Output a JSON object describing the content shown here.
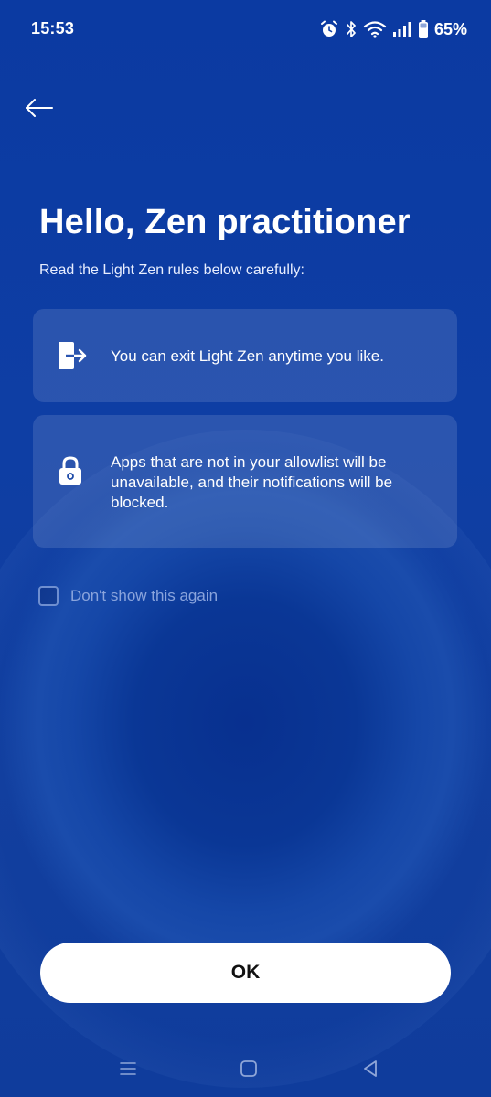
{
  "status_bar": {
    "time": "15:53",
    "battery_percent": "65%",
    "icons": [
      "alarm-icon",
      "bluetooth-icon",
      "wifi-icon",
      "signal-icon",
      "battery-icon"
    ]
  },
  "header": {
    "back_icon": "back-arrow-icon",
    "title": "Hello, Zen practitioner",
    "subtitle": "Read the Light Zen rules below carefully:"
  },
  "rules": [
    {
      "icon": "exit-icon",
      "text": "You can exit Light Zen anytime you like."
    },
    {
      "icon": "lock-icon",
      "text": "Apps that are not in your allowlist will be unavailable, and their notifications will be blocked."
    }
  ],
  "dont_show_again": {
    "label": "Don't show this again",
    "checked": false
  },
  "ok_button": {
    "label": "OK"
  },
  "nav_bar": {
    "icons": [
      "recent-apps-icon",
      "home-icon",
      "back-icon"
    ]
  },
  "colors": {
    "background": "#0e3ea4",
    "card": "rgba(255,255,255,0.12)",
    "button": "#ffffff",
    "checkbox_label": "#8aa4dc"
  }
}
